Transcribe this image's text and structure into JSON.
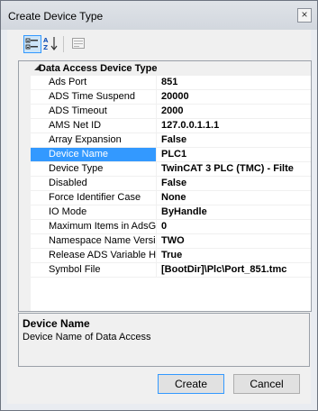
{
  "window": {
    "title": "Create Device Type"
  },
  "property_grid": {
    "category": "Data Access Device Type",
    "rows": [
      {
        "name": "Ads Port",
        "value": "851"
      },
      {
        "name": "ADS Time Suspend",
        "value": "20000"
      },
      {
        "name": "ADS Timeout",
        "value": "2000"
      },
      {
        "name": "AMS Net ID",
        "value": "127.0.0.1.1.1"
      },
      {
        "name": "Array Expansion",
        "value": "False"
      },
      {
        "name": "Device Name",
        "value": "PLC1",
        "selected": true
      },
      {
        "name": "Device Type",
        "value": "TwinCAT 3 PLC (TMC) - Filte"
      },
      {
        "name": "Disabled",
        "value": "False"
      },
      {
        "name": "Force Identifier Case",
        "value": "None"
      },
      {
        "name": "IO Mode",
        "value": "ByHandle"
      },
      {
        "name": "Maximum Items in AdsGet",
        "value": "0"
      },
      {
        "name": "Namespace Name Version",
        "value": "TWO"
      },
      {
        "name": "Release ADS Variable Ha",
        "value": "True"
      },
      {
        "name": "Symbol File",
        "value": "[BootDir]\\Plc\\Port_851.tmc"
      }
    ]
  },
  "help": {
    "title": "Device Name",
    "description": "Device Name of Data Access"
  },
  "buttons": {
    "create": "Create",
    "cancel": "Cancel"
  },
  "icons": {
    "categorized": "categorized-icon",
    "alphabetical": "sort-alphabetical-icon",
    "property_pages": "property-pages-icon",
    "close": "close-icon"
  },
  "colors": {
    "selection": "#3399ff"
  }
}
